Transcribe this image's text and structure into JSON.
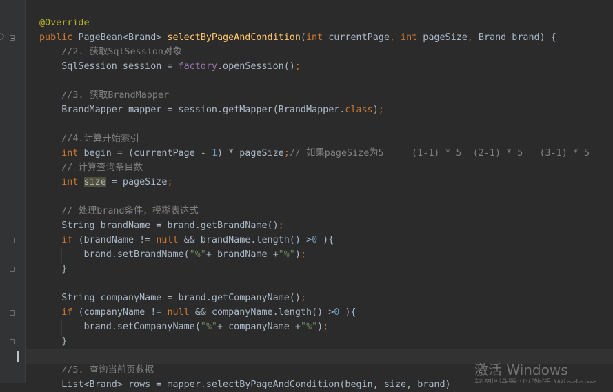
{
  "lines": [
    [
      {
        "t": "@Override",
        "c": "ann"
      }
    ],
    [
      {
        "t": "public ",
        "c": "kw"
      },
      {
        "t": "PageBean<Brand> ",
        "c": ""
      },
      {
        "t": "selectByPageAndCondition",
        "c": "fn"
      },
      {
        "t": "(",
        "c": ""
      },
      {
        "t": "int ",
        "c": "kw"
      },
      {
        "t": "currentPage",
        "c": ""
      },
      {
        "t": ", ",
        "c": "kw"
      },
      {
        "t": "int ",
        "c": "kw"
      },
      {
        "t": "pageSize",
        "c": ""
      },
      {
        "t": ", ",
        "c": "kw"
      },
      {
        "t": "Brand brand) {",
        "c": ""
      }
    ],
    [
      {
        "t": "    //2. 获取SqlSession对象",
        "c": "cmt"
      }
    ],
    [
      {
        "t": "    SqlSession session = ",
        "c": ""
      },
      {
        "t": "factory",
        "c": "fld"
      },
      {
        "t": ".openSession()",
        "c": ""
      },
      {
        "t": ";",
        "c": "kw"
      }
    ],
    [],
    [
      {
        "t": "    //3. 获取BrandMapper",
        "c": "cmt"
      }
    ],
    [
      {
        "t": "    BrandMapper mapper = session.getMapper(BrandMapper.",
        "c": ""
      },
      {
        "t": "class",
        "c": "kw"
      },
      {
        "t": ")",
        "c": ""
      },
      {
        "t": ";",
        "c": "kw"
      }
    ],
    [],
    [
      {
        "t": "    //4.计算开始索引",
        "c": "cmt"
      }
    ],
    [
      {
        "t": "    ",
        "c": ""
      },
      {
        "t": "int ",
        "c": "kw"
      },
      {
        "t": "begin = (currentPage - ",
        "c": ""
      },
      {
        "t": "1",
        "c": "num"
      },
      {
        "t": ") * pageSize",
        "c": ""
      },
      {
        "t": ";",
        "c": "kw"
      },
      {
        "t": "// 如果pageSize为5     (1-1) * 5  (2-1) * 5   (3-1) * 5",
        "c": "cmt"
      }
    ],
    [
      {
        "t": "    // 计算查询条目数",
        "c": "cmt"
      }
    ],
    [
      {
        "t": "    ",
        "c": ""
      },
      {
        "t": "int ",
        "c": "kw"
      },
      {
        "t": "size",
        "c": "hl"
      },
      {
        "t": " = pageSize",
        "c": ""
      },
      {
        "t": ";",
        "c": "kw"
      }
    ],
    [],
    [
      {
        "t": "    // 处理brand条件，模糊表达式",
        "c": "cmt"
      }
    ],
    [
      {
        "t": "    String brandName = brand.getBrandName()",
        "c": ""
      },
      {
        "t": ";",
        "c": "kw"
      }
    ],
    [
      {
        "t": "    ",
        "c": ""
      },
      {
        "t": "if ",
        "c": "kw"
      },
      {
        "t": "(brandName != ",
        "c": ""
      },
      {
        "t": "null ",
        "c": "kw"
      },
      {
        "t": "&& brandName.length() >",
        "c": ""
      },
      {
        "t": "0",
        "c": "num"
      },
      {
        "t": " ){",
        "c": ""
      }
    ],
    [
      {
        "t": "        brand.setBrandName(",
        "c": ""
      },
      {
        "t": "\"%\"",
        "c": "str"
      },
      {
        "t": "+ brandName +",
        "c": ""
      },
      {
        "t": "\"%\"",
        "c": "str"
      },
      {
        "t": ")",
        "c": ""
      },
      {
        "t": ";",
        "c": "kw"
      }
    ],
    [
      {
        "t": "    }",
        "c": ""
      }
    ],
    [],
    [
      {
        "t": "    String companyName = brand.getCompanyName()",
        "c": ""
      },
      {
        "t": ";",
        "c": "kw"
      }
    ],
    [
      {
        "t": "    ",
        "c": ""
      },
      {
        "t": "if ",
        "c": "kw"
      },
      {
        "t": "(companyName != ",
        "c": ""
      },
      {
        "t": "null ",
        "c": "kw"
      },
      {
        "t": "&& companyName.length() >",
        "c": ""
      },
      {
        "t": "0",
        "c": "num"
      },
      {
        "t": " ){",
        "c": ""
      }
    ],
    [
      {
        "t": "        brand.setCompanyName(",
        "c": ""
      },
      {
        "t": "\"%\"",
        "c": "str"
      },
      {
        "t": "+ companyName +",
        "c": ""
      },
      {
        "t": "\"%\"",
        "c": "str"
      },
      {
        "t": ")",
        "c": ""
      },
      {
        "t": ";",
        "c": "kw"
      }
    ],
    [
      {
        "t": "    }",
        "c": ""
      }
    ],
    [],
    [
      {
        "t": "    //5. 查询当前页数据",
        "c": "cmt"
      }
    ],
    [
      {
        "t": "    List<Brand> rows = mapper.selectByPageAndCondition(begin, size, brand)",
        "c": ""
      }
    ]
  ],
  "watermark": {
    "title": "激活 Windows",
    "subtitle": "转到\"设置\"以激活 Windows。"
  },
  "colors": {
    "background": "#2b2b2b",
    "keyword": "#cc7832",
    "annotation": "#bbb529",
    "method": "#ffc66d",
    "field": "#9876aa",
    "number": "#6897bb",
    "string": "#6a8759",
    "comment": "#808080"
  }
}
